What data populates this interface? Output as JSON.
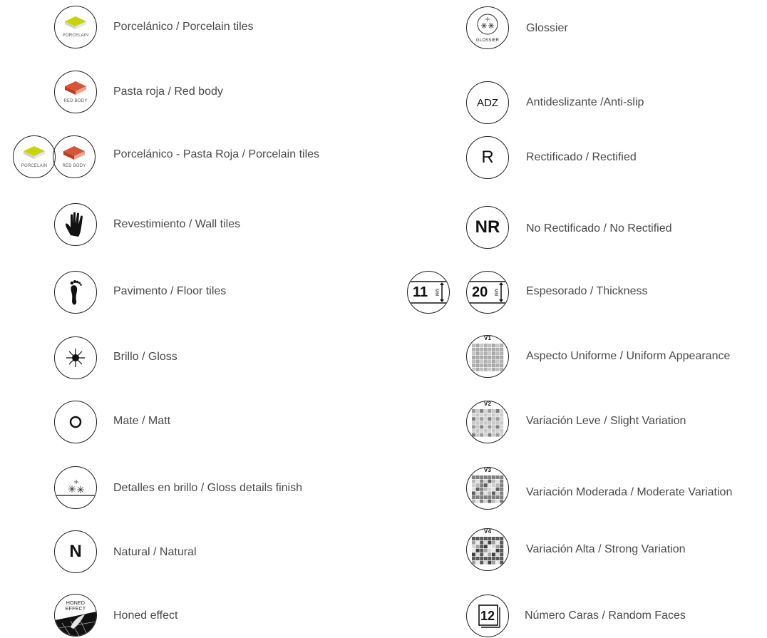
{
  "left": [
    {
      "label": "Porcelánico / Porcelain tiles",
      "icon": "porcelain-icon",
      "cap": "PORCELAIN"
    },
    {
      "label": "Pasta roja / Red body",
      "icon": "red-body-icon",
      "cap": "RED BODY"
    },
    {
      "label": "Porcelánico - Pasta Roja /  Porcelain tiles",
      "icon": "porcelain-red-body-icon",
      "cap1": "PORCELAIN",
      "cap2": "RED BODY"
    },
    {
      "label": "Revestimiento / Wall tiles",
      "icon": "hand-icon"
    },
    {
      "label": "Pavimento / Floor tiles",
      "icon": "foot-icon"
    },
    {
      "label": "Brillo / Gloss",
      "icon": "sun-gloss-icon"
    },
    {
      "label": "Mate / Matt",
      "icon": "matt-circle-icon"
    },
    {
      "label": "Detalles en brillo / Gloss details finish",
      "icon": "gloss-details-icon"
    },
    {
      "label": "Natural / Natural",
      "icon": "natural-icon",
      "glyph": "N"
    },
    {
      "label": "Honed effect",
      "icon": "honed-effect-icon",
      "cap1": "HONED",
      "cap2": "EFFECT"
    }
  ],
  "right": [
    {
      "label": "Glossier",
      "icon": "glossier-icon",
      "cap": "GLOSSIER"
    },
    {
      "label": "Antideslizante /Anti-slip",
      "icon": "anti-slip-icon",
      "glyph": "ADZ"
    },
    {
      "label": "Rectificado / Rectified",
      "icon": "rectified-icon",
      "glyph": "R"
    },
    {
      "label": "No Rectificado / No Rectified",
      "icon": "no-rectified-icon",
      "glyph": "NR"
    },
    {
      "label": "Espesorado / Thickness",
      "icon": "thickness-icon",
      "glyph1": "11",
      "glyph2": "20",
      "unit": "MM"
    },
    {
      "label": "Aspecto Uniforme / Uniform Appearance",
      "icon": "variation-v1-icon",
      "tag": "V1"
    },
    {
      "label": "Variación Leve / Slight Variation",
      "icon": "variation-v2-icon",
      "tag": "V2"
    },
    {
      "label": "Variación Moderada / Moderate Variation",
      "icon": "variation-v3-icon",
      "tag": "V3"
    },
    {
      "label": "Variación Alta / Strong Variation",
      "icon": "variation-v4-icon",
      "tag": "V4"
    },
    {
      "label": "Número Caras / Random Faces",
      "icon": "random-faces-icon",
      "glyph": "12"
    }
  ],
  "colors": {
    "porcelain_top": "#c8d400",
    "porcelain_side": "#d9d9d9",
    "red_top": "#d9553a",
    "red_side": "#f2a08c",
    "text": "#4a4a4a"
  }
}
